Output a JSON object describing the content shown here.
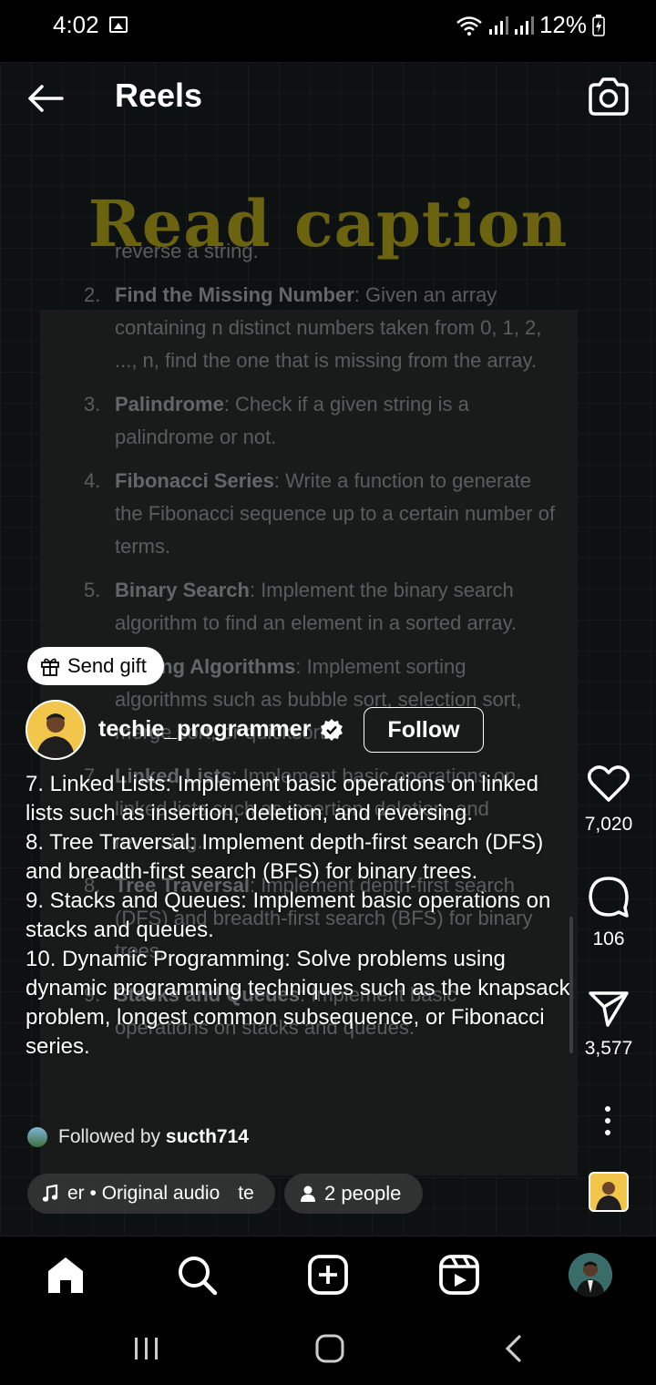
{
  "status_bar": {
    "time": "4:02",
    "battery": "12%"
  },
  "app_bar": {
    "title": "Reels"
  },
  "video": {
    "heading": "Read caption",
    "items": [
      {
        "num": "",
        "title": "",
        "text": "reverse a string."
      },
      {
        "num": "2.",
        "title": "Find the Missing Number",
        "text": ": Given an array containing n distinct numbers taken from 0, 1, 2, ..., n, find the one that is missing from the array."
      },
      {
        "num": "3.",
        "title": "Palindrome",
        "text": ": Check if a given string is a palindrome or not."
      },
      {
        "num": "4.",
        "title": "Fibonacci Series",
        "text": ": Write a function to generate the Fibonacci sequence up to a certain number of terms."
      },
      {
        "num": "5.",
        "title": "Binary Search",
        "text": ": Implement the binary search algorithm to find an element in a sorted array."
      },
      {
        "num": "6.",
        "title": "Sorting Algorithms",
        "text": ": Implement sorting algorithms such as bubble sort, selection sort, merge sort, or quicksort."
      },
      {
        "num": "7.",
        "title": "Linked Lists",
        "text": ": Implement basic operations on linked lists such as insertion, deletion, and reversing."
      },
      {
        "num": "8.",
        "title": "Tree Traversal",
        "text": ": Implement depth-first search (DFS) and breadth-first search (BFS) for binary trees."
      },
      {
        "num": "9.",
        "title": "Stacks and Queues",
        "text": ": Implement basic operations on stacks and queues."
      }
    ]
  },
  "send_gift": {
    "label": "Send gift"
  },
  "profile": {
    "username": "techie_programmer",
    "follow_label": "Follow"
  },
  "caption": {
    "lines": [
      "7. Linked Lists: Implement basic operations on linked lists such as insertion, deletion, and reversing.",
      "8. Tree Traversal: Implement depth-first search (DFS) and breadth-first search (BFS) for binary trees.",
      "9. Stacks and Queues: Implement basic operations on stacks and queues.",
      "10. Dynamic Programming: Solve problems using dynamic programming techniques such as the knapsack problem, longest common subsequence, or Fibonacci series."
    ]
  },
  "followed_by": {
    "prefix": "Followed by",
    "user": "sucth714"
  },
  "audio": {
    "label": "er • Original audio",
    "trailing": "te"
  },
  "people": {
    "label": "2 people"
  },
  "actions": {
    "likes": "7,020",
    "comments": "106",
    "shares": "3,577"
  },
  "colors": {
    "heading": "#6b6310",
    "avatar_bg": "#f2c54b",
    "background": "#000000"
  },
  "icons": [
    "back-arrow-icon",
    "camera-icon",
    "gift-icon",
    "verified-icon",
    "heart-icon",
    "comment-icon",
    "share-icon",
    "more-icon",
    "music-icon",
    "person-icon",
    "home-icon",
    "search-icon",
    "create-icon",
    "reels-icon"
  ]
}
